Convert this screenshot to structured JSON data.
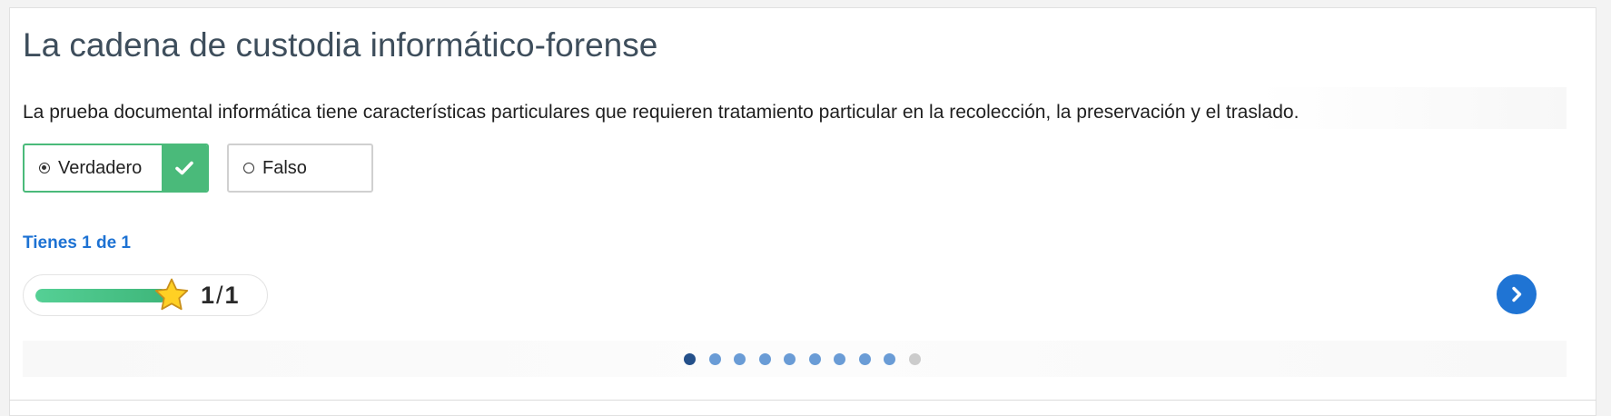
{
  "activity": {
    "title": "La cadena de custodia informático-forense",
    "question": "La prueba documental informática tiene características particulares que requieren tratamiento particular en la recolección, la preservación y el traslado.",
    "options": [
      {
        "label": "Verdadero",
        "selected": true,
        "correct": true
      },
      {
        "label": "Falso",
        "selected": false
      }
    ]
  },
  "feedback": {
    "status": "Tienes 1 de 1",
    "score": "1",
    "score_sep": "/",
    "score_total": "1",
    "progress": 1.0
  },
  "pagination": {
    "dots": [
      "active",
      "filled",
      "filled",
      "filled",
      "filled",
      "filled",
      "filled",
      "filled",
      "filled",
      "empty"
    ]
  },
  "icons": {
    "check": "check-icon",
    "star": "star-icon",
    "next": "chevron-right-icon"
  },
  "colors": {
    "correct": "#4aba7a",
    "accent": "#1f74d4",
    "title": "#3e4e5c",
    "dot_active": "#24508a",
    "dot_filled": "#6a9cd6",
    "dot_empty": "#cccccc"
  }
}
